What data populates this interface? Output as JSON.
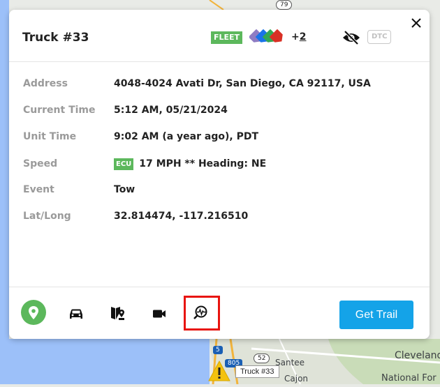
{
  "map": {
    "labels": [
      "Cleveland",
      "National For",
      "Santee",
      "Cajon"
    ],
    "shields": [
      "79",
      "52",
      "805",
      "5"
    ],
    "tooltip": "Truck #33",
    "warning_icon": "warning-triangle-icon"
  },
  "header": {
    "title": "Truck #33",
    "fleet_badge": "FLEET",
    "tag_colors": [
      "#8e7cc3",
      "#1a73e8",
      "#34a853",
      "#d93025"
    ],
    "more_prefix": "+",
    "more_count": "2",
    "dtc_label": "DTC",
    "icons": [
      "eye-off-icon",
      "close-icon"
    ]
  },
  "details": {
    "address_label": "Address",
    "address_value": "4048-4024 Avati Dr, San Diego, CA 92117, USA",
    "current_time_label": "Current Time",
    "current_time_value": "5:12 AM, 05/21/2024",
    "unit_time_label": "Unit Time",
    "unit_time_value": "9:02 AM (a year ago), PDT",
    "speed_label": "Speed",
    "speed_badge": "ECU",
    "speed_value": "17 MPH ** Heading: NE",
    "event_label": "Event",
    "event_value": "Tow",
    "latlong_label": "Lat/Long",
    "latlong_value": "32.814474, -117.216510"
  },
  "footer": {
    "icons": [
      "location-pin-icon",
      "car-icon",
      "geofence-icon",
      "video-camera-icon",
      "diagnostics-search-icon"
    ],
    "get_trail_label": "Get Trail",
    "accent_color": "#14a3e8",
    "location_color": "#5cb85c",
    "highlight_color": "#e8140f"
  }
}
